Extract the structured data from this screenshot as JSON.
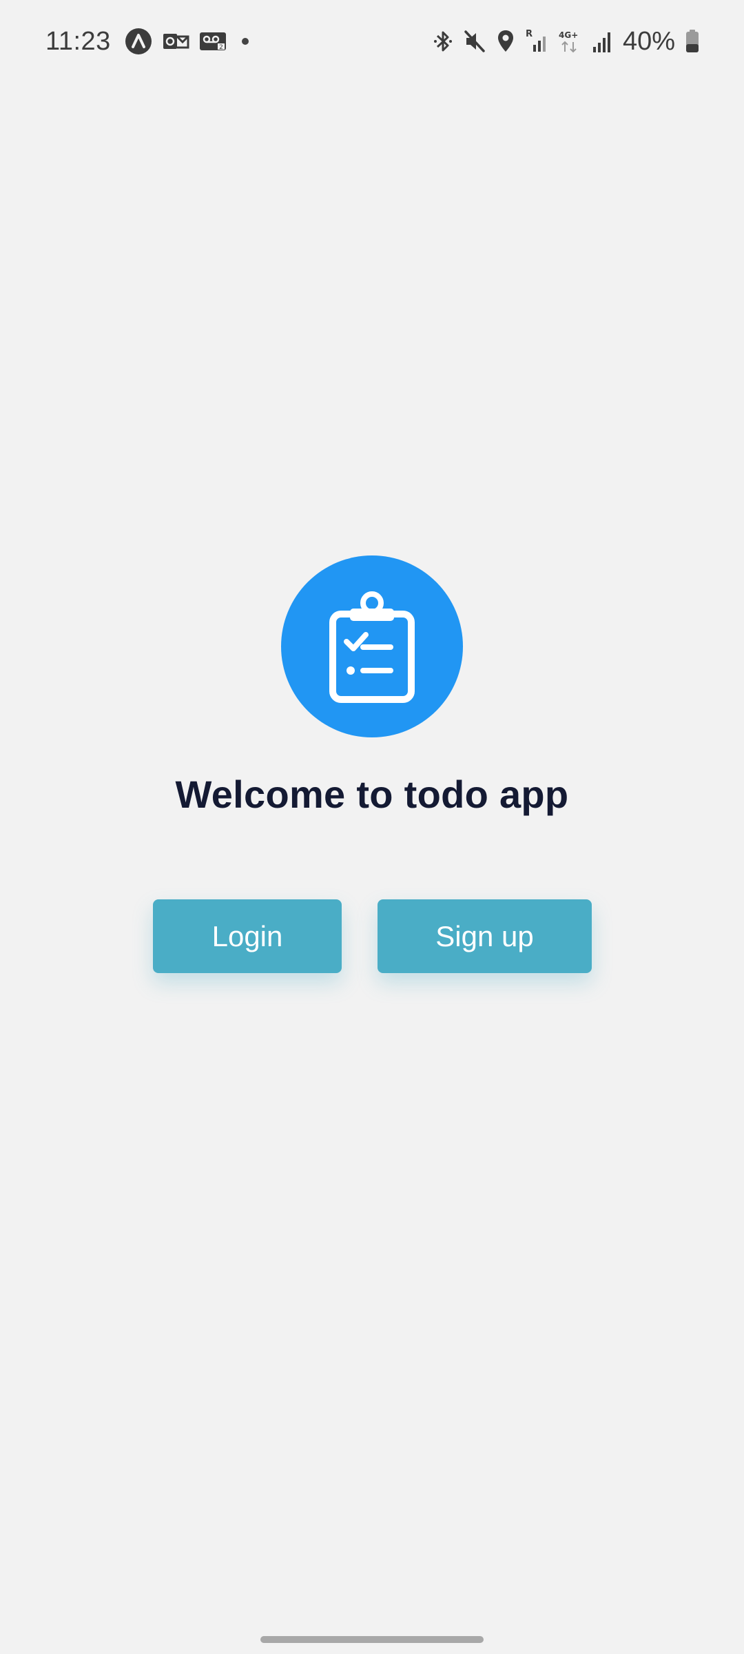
{
  "status_bar": {
    "time": "11:23",
    "battery_percent": "40%",
    "battery_level": 0.4,
    "left_icons": [
      "app-a-icon",
      "outlook-icon",
      "voicemail-icon",
      "notification-dot-icon"
    ],
    "right_icons": [
      "bluetooth-icon",
      "mute-icon",
      "location-icon",
      "roaming-signal-icon",
      "4g-plus-icon",
      "signal-icon",
      "battery-icon"
    ],
    "network_label": "4G+",
    "roaming_label": "R"
  },
  "main": {
    "logo_icon": "clipboard-checklist-icon",
    "logo_color": "#2196f3",
    "title": "Welcome to todo app",
    "buttons": {
      "login_label": "Login",
      "signup_label": "Sign up"
    },
    "button_color": "#4aadc6"
  }
}
